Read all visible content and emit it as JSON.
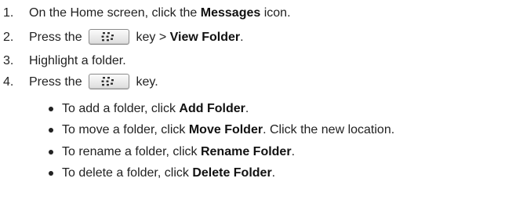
{
  "steps": [
    {
      "number": "1.",
      "pre": "On the Home screen, click the ",
      "bold": "Messages",
      "post": " icon."
    },
    {
      "number": "2.",
      "pre": "Press the ",
      "key_icon": "blackberry-menu-key-icon",
      "mid": " key > ",
      "bold": "View Folder",
      "post": "."
    },
    {
      "number": "3.",
      "text": "Highlight a folder."
    },
    {
      "number": "4.",
      "pre": "Press the ",
      "key_icon": "blackberry-menu-key-icon",
      "post": " key."
    }
  ],
  "bullets": [
    {
      "pre": "To add a folder, click ",
      "bold": "Add Folder",
      "post": "."
    },
    {
      "pre": "To move a folder, click ",
      "bold": "Move Folder",
      "post": ". Click the new location."
    },
    {
      "pre": "To rename a folder, click ",
      "bold": "Rename Folder",
      "post": "."
    },
    {
      "pre": "To delete a folder, click ",
      "bold": "Delete Folder",
      "post": "."
    }
  ]
}
